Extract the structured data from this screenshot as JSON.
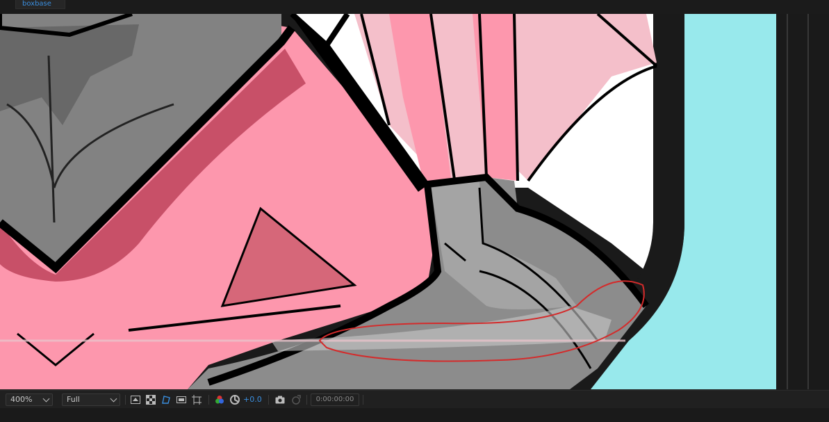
{
  "tab": {
    "label": "boxbase"
  },
  "toolbar": {
    "zoom": "400%",
    "resolution": "Full",
    "exposure": "+0.0",
    "timecode": "0:00:00:00"
  },
  "icons": {
    "fast_previews": "fast-previews-icon",
    "transparency_grid": "transparency-grid-icon",
    "mask_visibility": "mask-visibility-icon",
    "region_of_interest": "region-of-interest-icon",
    "guides": "grid-guides-icon",
    "channels": "color-channels-icon",
    "color_management": "color-management-icon",
    "snapshot": "camera-icon",
    "show_snapshot": "show-snapshot-icon"
  },
  "colors": {
    "accent": "#3a8fe0",
    "pink": "#fd97ad",
    "dark_pink": "#c85068",
    "light_pink": "#f4bfca",
    "gray": "#8c8c8c",
    "light_gray": "#a4a4a4",
    "cyan": "#98e9ec",
    "annotation_red": "#d42b2b"
  }
}
